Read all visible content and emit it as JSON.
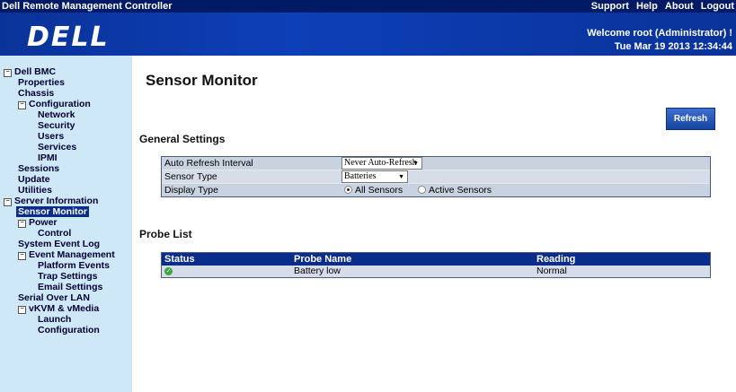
{
  "topbar": {
    "title": "Dell Remote Management Controller",
    "links": [
      "Support",
      "Help",
      "About",
      "Logout"
    ]
  },
  "banner": {
    "logo": "DELL",
    "welcome": "Welcome root (Administrator) !",
    "datetime": "Tue Mar 19 2013 12:34:44"
  },
  "sidebar": {
    "items": [
      {
        "label": "Dell BMC",
        "expander": "⊟"
      },
      {
        "label": "Properties"
      },
      {
        "label": "Chassis"
      },
      {
        "label": "Configuration",
        "expander": "⊟"
      },
      {
        "label": "Network"
      },
      {
        "label": "Security"
      },
      {
        "label": "Users"
      },
      {
        "label": "Services"
      },
      {
        "label": "IPMI"
      },
      {
        "label": "Sessions"
      },
      {
        "label": "Update"
      },
      {
        "label": "Utilities"
      },
      {
        "label": "Server Information",
        "expander": "⊟"
      },
      {
        "label": "Sensor Monitor",
        "selected": true
      },
      {
        "label": "Power",
        "expander": "⊟"
      },
      {
        "label": "Control"
      },
      {
        "label": "System Event Log"
      },
      {
        "label": "Event Management",
        "expander": "⊟"
      },
      {
        "label": "Platform Events"
      },
      {
        "label": "Trap Settings"
      },
      {
        "label": "Email Settings"
      },
      {
        "label": "Serial Over LAN"
      },
      {
        "label": "vKVM & vMedia",
        "expander": "⊟"
      },
      {
        "label": "Launch"
      },
      {
        "label": "Configuration"
      }
    ]
  },
  "main": {
    "title": "Sensor Monitor",
    "refresh_label": "Refresh",
    "general_settings": {
      "heading": "General Settings",
      "auto_refresh_label": "Auto Refresh Interval",
      "auto_refresh_value": "Never Auto-Refresh",
      "sensor_type_label": "Sensor Type",
      "sensor_type_value": "Batteries",
      "display_type_label": "Display Type",
      "display_all": "All Sensors",
      "display_active": "Active Sensors",
      "display_selected": "All Sensors"
    },
    "probe_list": {
      "heading": "Probe List",
      "columns": [
        "Status",
        "Probe Name",
        "Reading"
      ],
      "rows": [
        {
          "status": "ok",
          "name": "Battery low",
          "reading": "Normal"
        }
      ]
    }
  },
  "colors": {
    "topbar": "#001a66",
    "banner": "#0a3399",
    "sidebar": "#cfe8f7",
    "selected": "#0a2d8c"
  }
}
